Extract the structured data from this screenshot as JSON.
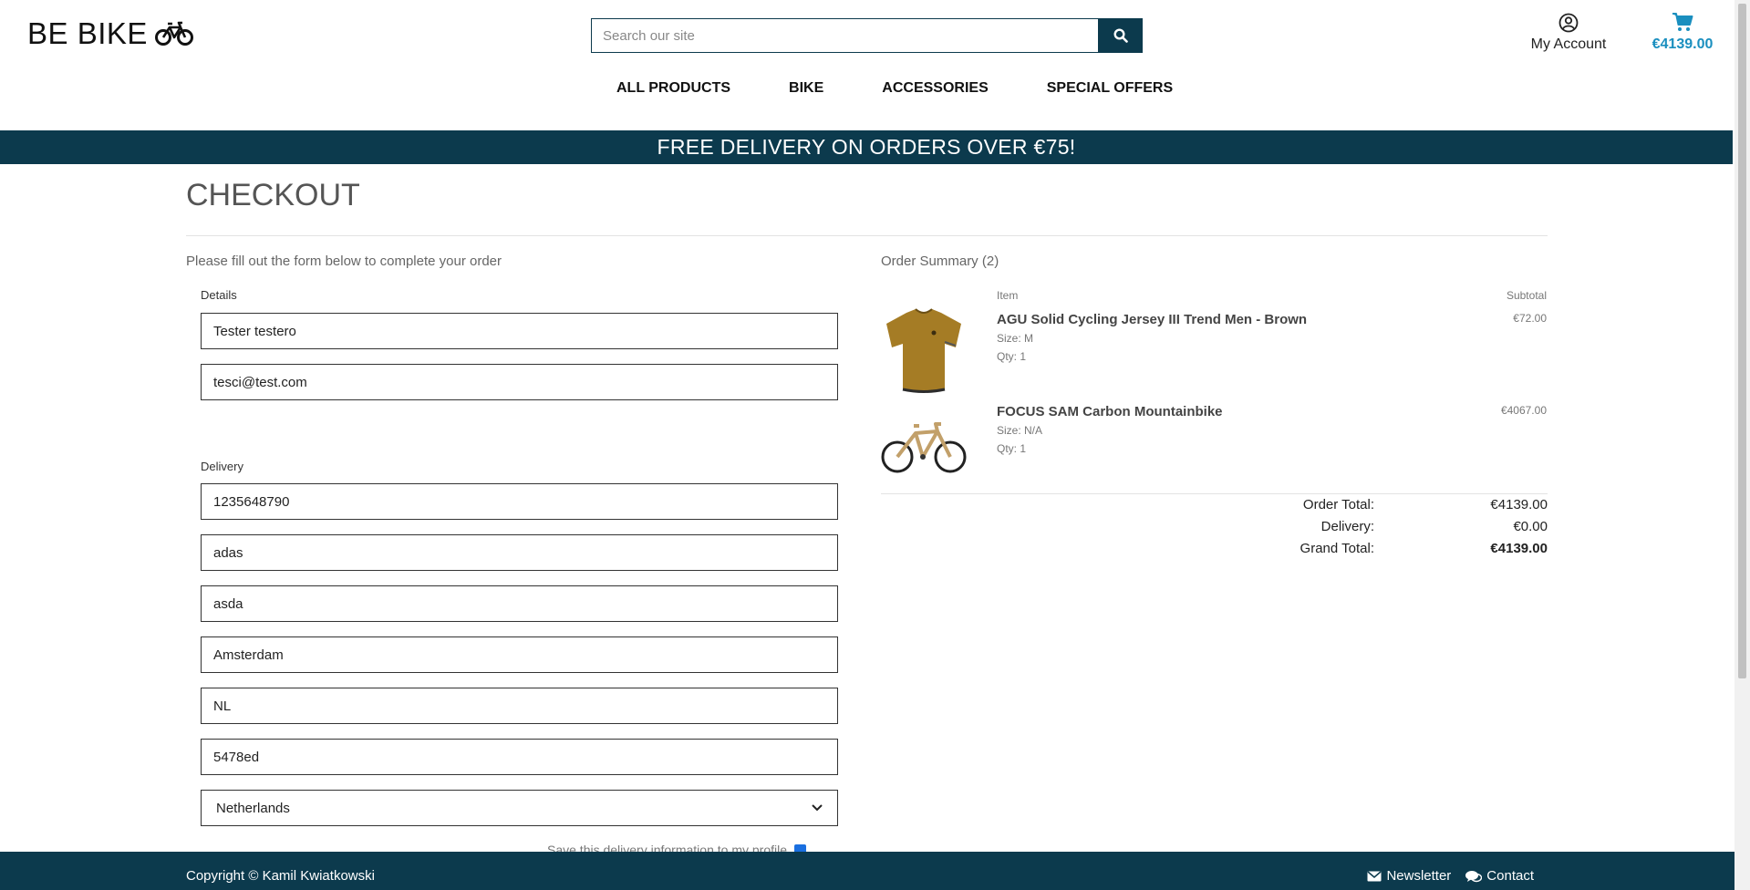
{
  "header": {
    "logo_text": "BE BIKE",
    "search_placeholder": "Search our site",
    "account_label": "My Account",
    "cart_total": "€4139.00",
    "accent_color": "#0c3a4d",
    "cart_color": "#1a8fbf"
  },
  "nav": {
    "items": [
      "ALL PRODUCTS",
      "BIKE",
      "ACCESSORIES",
      "SPECIAL OFFERS"
    ]
  },
  "banner": {
    "text": "FREE DELIVERY ON ORDERS OVER €75!"
  },
  "checkout": {
    "title": "CHECKOUT",
    "intro": "Please fill out the form below to complete your order",
    "details_label": "Details",
    "delivery_label": "Delivery",
    "fields": {
      "full_name": "Tester testero",
      "email": "tesci@test.com",
      "phone": "1235648790",
      "street1": "adas",
      "street2": "asda",
      "town": "Amsterdam",
      "county": "NL",
      "postcode": "5478ed",
      "country": "Netherlands"
    },
    "save_info_label": "Save this delivery information to my profile"
  },
  "summary": {
    "title": "Order Summary (2)",
    "col_item": "Item",
    "col_subtotal": "Subtotal",
    "items": [
      {
        "name": "AGU Solid Cycling Jersey III Trend Men - Brown",
        "size": "Size: M",
        "qty": "Qty: 1",
        "price": "€72.00",
        "icon": "jersey-image"
      },
      {
        "name": "FOCUS SAM Carbon Mountainbike",
        "size": "Size: N/A",
        "qty": "Qty: 1",
        "price": "€4067.00",
        "icon": "bike-image"
      }
    ],
    "order_total_label": "Order Total:",
    "order_total": "€4139.00",
    "delivery_label": "Delivery:",
    "delivery": "€0.00",
    "grand_total_label": "Grand Total:",
    "grand_total": "€4139.00"
  },
  "footer": {
    "copyright": "Copyright © Kamil Kwiatkowski",
    "newsletter": "Newsletter",
    "contact": "Contact"
  }
}
